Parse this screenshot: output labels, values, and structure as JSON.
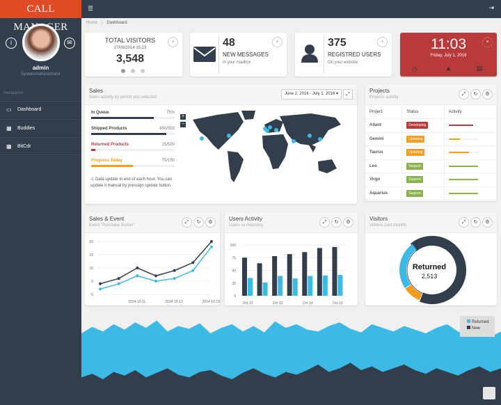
{
  "app": {
    "title": "CALL MANAGER",
    "menu_icon": "hamburger-icon",
    "logout_icon": "sign-out-icon"
  },
  "profile": {
    "name": "admin",
    "role": "System/Administrator",
    "info_icon": "info-icon",
    "mail_icon": "envelope-icon"
  },
  "sidebar": {
    "section": "Navigation",
    "items": [
      {
        "label": "Dashboard",
        "icon": "monitor-icon"
      },
      {
        "label": "Buddies",
        "icon": "table-icon"
      },
      {
        "label": "BitCdr",
        "icon": "table-icon"
      }
    ]
  },
  "breadcrumb": {
    "home": "Home",
    "sep": "›",
    "current": "Dashboard"
  },
  "stats": {
    "visitors": {
      "title": "TOTAL VISITORS",
      "date": "27/08/2014 15:23",
      "value": "3,548"
    },
    "messages": {
      "value": "48",
      "title": "NEW MESSAGES",
      "sub": "In your mailbox"
    },
    "users": {
      "value": "375",
      "title": "REGISTRED USERS",
      "sub": "On your website"
    },
    "clock": {
      "time": "11:03",
      "date": "Friday, July 1, 2016"
    },
    "close": "×"
  },
  "sales": {
    "title": "Sales",
    "subtitle": "Sales activity by period you selected",
    "date_range": "June 2, 2016 - July 1, 2016 ▾",
    "progress": [
      {
        "label": "In Queue",
        "value": "75%",
        "fraction": 0.75,
        "color": "#323e4c"
      },
      {
        "label": "Shipped Products",
        "value": "450/500",
        "fraction": 0.9,
        "color": "#323e4c"
      },
      {
        "label": "Returned Products",
        "value": "25/500",
        "fraction": 0.05,
        "color": "#b83a3a"
      },
      {
        "label": "Progress Today",
        "value": "75/150",
        "fraction": 0.5,
        "color": "#f39c1f"
      }
    ],
    "note": "⚠ Data update in end of each hour. You can update it manual by pressign update button",
    "zoom_in": "+",
    "zoom_out": "−"
  },
  "projects": {
    "title": "Projects",
    "subtitle": "Projects activity",
    "columns": [
      "Project",
      "Status",
      "Activity"
    ],
    "rows": [
      {
        "name": "Atlant",
        "status": "Developing",
        "color": "#b83a3a",
        "activity": 0.85
      },
      {
        "name": "Gemini",
        "status": "Updating",
        "color": "#f39c1f",
        "activity": 0.4
      },
      {
        "name": "Taurus",
        "status": "Updating",
        "color": "#f39c1f",
        "activity": 0.7
      },
      {
        "name": "Leo",
        "status": "Support",
        "color": "#8ab34a",
        "activity": 1
      },
      {
        "name": "Virgo",
        "status": "Support",
        "color": "#8ab34a",
        "activity": 1
      },
      {
        "name": "Aquarius",
        "status": "Support",
        "color": "#8ab34a",
        "activity": 1
      }
    ]
  },
  "panels": {
    "sales_event": {
      "title": "Sales & Event",
      "subtitle": "Event \"Purchase Button\""
    },
    "users_activity": {
      "title": "Users Activity",
      "subtitle": "Users vs returning"
    },
    "visitors": {
      "title": "Visitors",
      "subtitle": "Visitors (last month)"
    }
  },
  "chart_data": [
    {
      "type": "line",
      "x": [
        "2014-10-10",
        "2014-10-11",
        "2014-10-12",
        "2014-10-13",
        "2014-10-14",
        "2014-10-15",
        "2014-10-16"
      ],
      "xticks": [
        "2014-10-11",
        "2014-10-13",
        "2014-10-15"
      ],
      "yticks": [
        "0",
        "5",
        "10",
        "15",
        "20"
      ],
      "ylim": [
        0,
        20
      ],
      "series": [
        {
          "color": "#323e4c",
          "values": [
            4,
            6,
            10,
            7,
            9,
            12,
            20
          ]
        },
        {
          "color": "#3db9e6",
          "values": [
            2,
            4,
            7,
            5,
            6,
            9,
            18
          ]
        }
      ]
    },
    {
      "type": "bar",
      "categories": [
        "Oct 10",
        "Oct 11",
        "Oct 12",
        "Oct 13",
        "Oct 14",
        "Oct 15",
        "Oct 16"
      ],
      "xticks": [
        "Oct 10",
        "Oct 12",
        "Oct 14",
        "Oct 16"
      ],
      "yticks": [
        "0",
        "25",
        "50",
        "75",
        "100"
      ],
      "ylim": [
        0,
        100
      ],
      "series": [
        {
          "color": "#323e4c",
          "values": [
            75,
            64,
            78,
            82,
            86,
            94,
            96
          ]
        },
        {
          "color": "#3db9e6",
          "values": [
            35,
            26,
            39,
            34,
            39,
            40,
            41
          ]
        }
      ]
    },
    {
      "type": "pie",
      "center_label": "Returned",
      "center_value": "2,513",
      "slices": [
        {
          "color": "#323e4c",
          "value": 67
        },
        {
          "color": "#f39c1f",
          "value": 9
        },
        {
          "color": "#3db9e6",
          "value": 24
        }
      ]
    },
    {
      "type": "area",
      "legend": [
        "Returned",
        "New"
      ],
      "legend_position": "top-right",
      "series": [
        {
          "name": "Returned",
          "color": "#3db9e6",
          "values": [
            78,
            85,
            80,
            88,
            82,
            90,
            84,
            92,
            80,
            86,
            83,
            89,
            78,
            84,
            88,
            80,
            86,
            79,
            91,
            84,
            88,
            82,
            80,
            86,
            90,
            83,
            79,
            88,
            84,
            80,
            86,
            82,
            78,
            84,
            88,
            80,
            76,
            82,
            74,
            80
          ]
        },
        {
          "name": "New",
          "color": "#323e4c",
          "values": [
            30,
            34,
            28,
            36,
            32,
            38,
            30,
            35,
            40,
            33,
            30,
            36,
            38,
            32,
            28,
            35,
            40,
            34,
            30,
            36,
            33,
            38,
            44,
            36,
            40,
            46,
            38,
            42,
            36,
            40,
            44,
            38,
            34,
            40,
            36,
            32,
            38,
            42,
            36,
            40
          ]
        }
      ]
    }
  ]
}
